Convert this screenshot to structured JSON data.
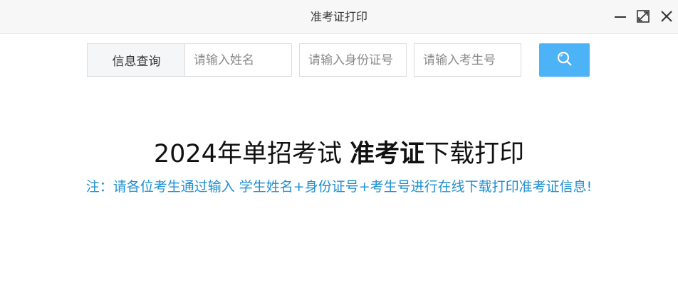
{
  "window": {
    "title": "准考证打印",
    "controls": {
      "minimize_icon": "minimize-icon",
      "maximize_icon": "maximize-icon",
      "close_icon": "close-icon"
    }
  },
  "search": {
    "label": "信息查询",
    "name_placeholder": "请输入姓名",
    "id_placeholder": "请输入身份证号",
    "exam_no_placeholder": "请输入考生号",
    "name_value": "",
    "id_value": "",
    "exam_no_value": "",
    "button_icon": "search-icon"
  },
  "headline": {
    "prefix": "2024年单招考试 ",
    "bold": "准考证",
    "suffix": "下载打印"
  },
  "notice": "注：请各位考生通过输入 学生姓名+身份证号+考生号进行在线下载打印准考证信息!",
  "colors": {
    "accent": "#4db3f7",
    "notice": "#1e8fd0",
    "titlebar": "#f7f7f7"
  }
}
